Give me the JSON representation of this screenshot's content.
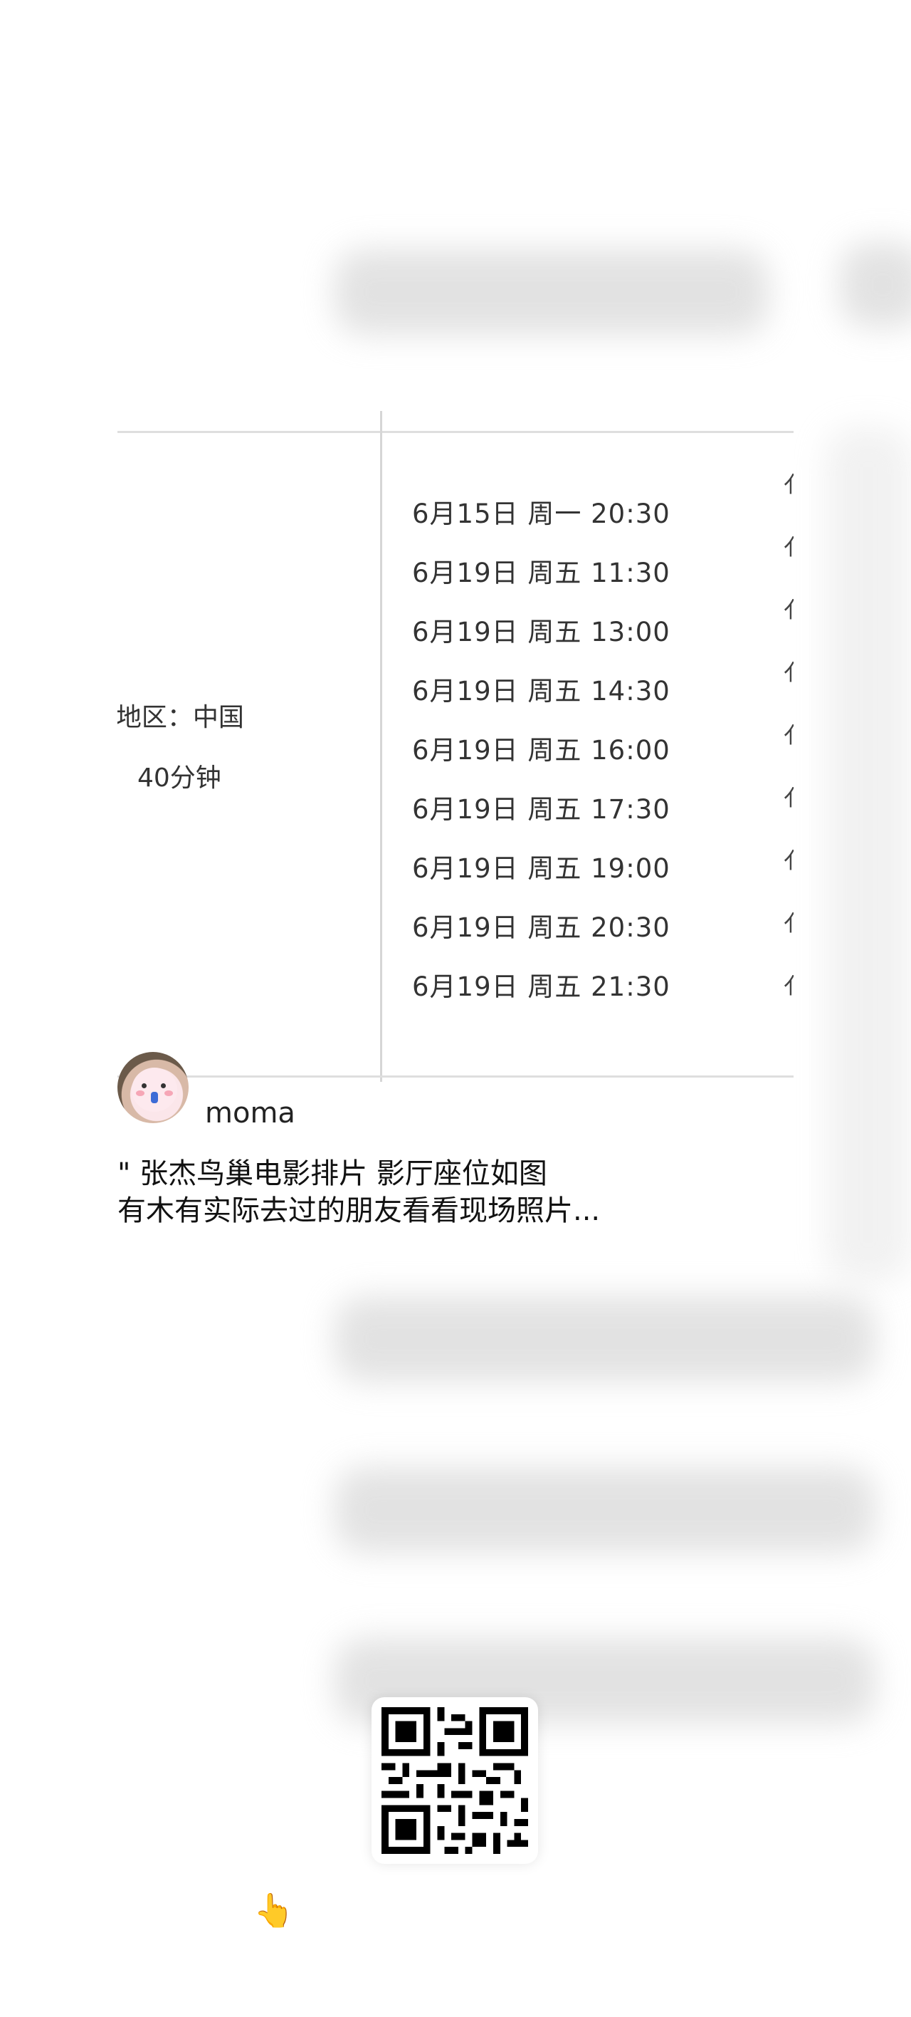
{
  "info": {
    "region": "'地区：中国",
    "duration": "40分钟"
  },
  "schedule": [
    "6月15日 周一 20:30",
    "6月19日 周五 11:30",
    "6月19日 周五 13:00",
    "6月19日 周五 14:30",
    "6月19日 周五 16:00",
    "6月19日 周五 17:30",
    "6月19日 周五 19:00",
    "6月19日 周五 20:30",
    "6月19日 周五 21:30"
  ],
  "edge_glyph": "亻",
  "post": {
    "username": "moma",
    "line1": "\" 张杰鸟巢电影排片 影厅座位如图",
    "line2": "有木有实际去过的朋友看看现场照片..."
  },
  "icons": {
    "avatar": "avatar-illustration",
    "qr": "qr-code-icon",
    "hand": "pointing-hand-icon",
    "hand_glyph": "👆"
  }
}
